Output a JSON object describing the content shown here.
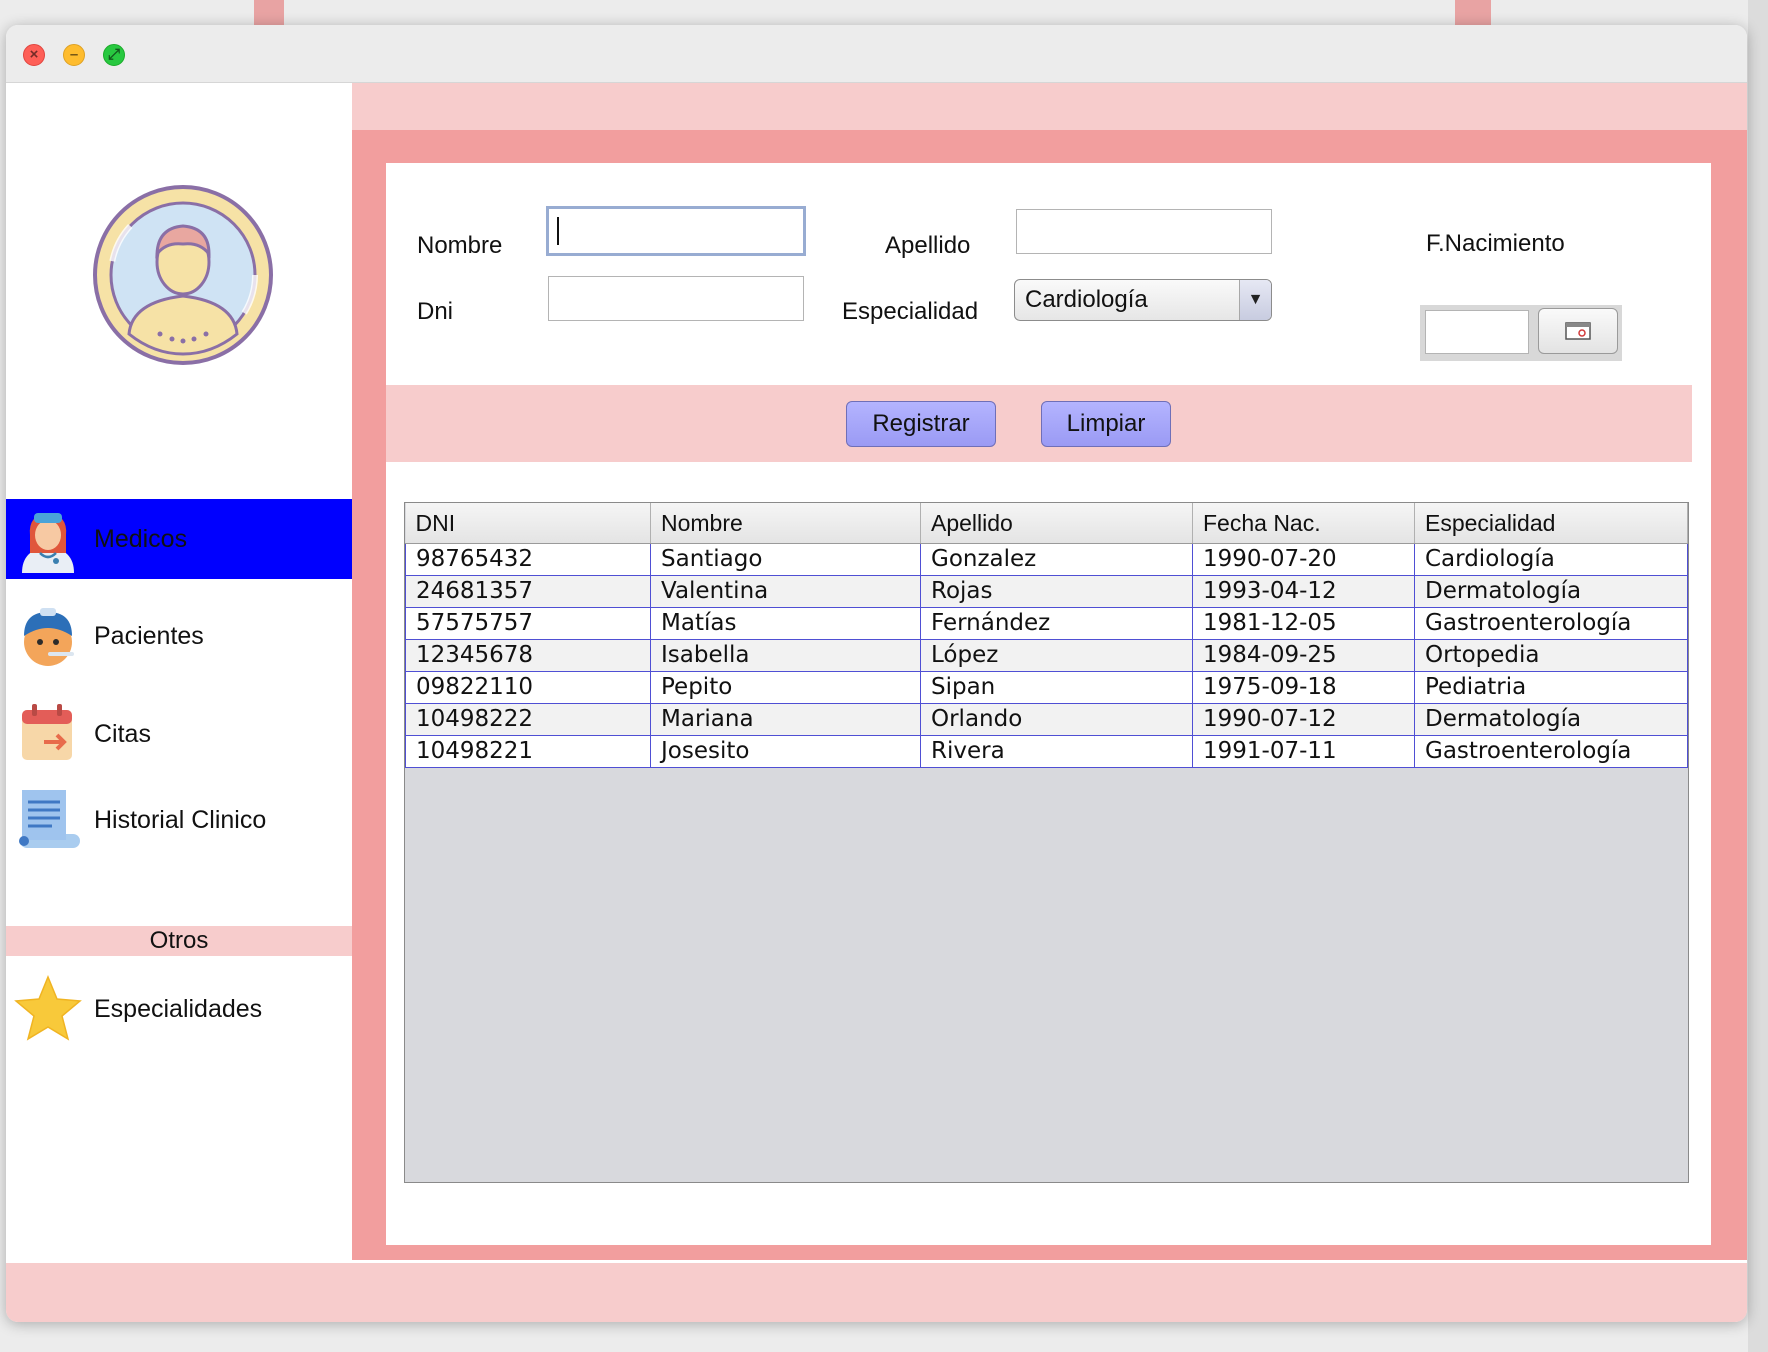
{
  "sidebar": {
    "items": [
      {
        "label": "Medicos",
        "icon": "doctor-icon",
        "active": true
      },
      {
        "label": "Pacientes",
        "icon": "patient-icon",
        "active": false
      },
      {
        "label": "Citas",
        "icon": "calendar-icon",
        "active": false
      },
      {
        "label": "Historial Clinico",
        "icon": "medical-record-icon",
        "active": false
      }
    ],
    "section_header": "Otros",
    "extra_items": [
      {
        "label": "Especialidades",
        "icon": "star-icon"
      }
    ]
  },
  "form": {
    "nombre_label": "Nombre",
    "nombre_value": "",
    "apellido_label": "Apellido",
    "apellido_value": "",
    "fnacimiento_label": "F.Nacimiento",
    "fnacimiento_value": "",
    "dni_label": "Dni",
    "dni_value": "",
    "especialidad_label": "Especialidad",
    "especialidad_selected": "Cardiología",
    "register_label": "Registrar",
    "clear_label": "Limpiar"
  },
  "table": {
    "columns": [
      "DNI",
      "Nombre",
      "Apellido",
      "Fecha Nac.",
      "Especialidad"
    ],
    "rows": [
      [
        "98765432",
        "Santiago",
        "Gonzalez",
        "1990-07-20",
        "Cardiología"
      ],
      [
        "24681357",
        "Valentina",
        "Rojas",
        "1993-04-12",
        "Dermatología"
      ],
      [
        "57575757",
        "Matías",
        "Fernández",
        "1981-12-05",
        "Gastroenterología"
      ],
      [
        "12345678",
        "Isabella",
        "López",
        "1984-09-25",
        "Ortopedia"
      ],
      [
        "09822110",
        "Pepito",
        "Sipan",
        "1975-09-18",
        "Pediatria"
      ],
      [
        "10498222",
        "Mariana",
        "Orlando",
        "1990-07-12",
        "Dermatología"
      ],
      [
        "10498221",
        "Josesito",
        "Rivera",
        "1991-07-11",
        "Gastroenterología"
      ]
    ]
  },
  "colors": {
    "accent_pink": "#f29e9e",
    "light_pink": "#f7cccc",
    "active_nav": "#0000ff",
    "button": "#a6a6fb",
    "grid_line": "#4f4fd4"
  }
}
